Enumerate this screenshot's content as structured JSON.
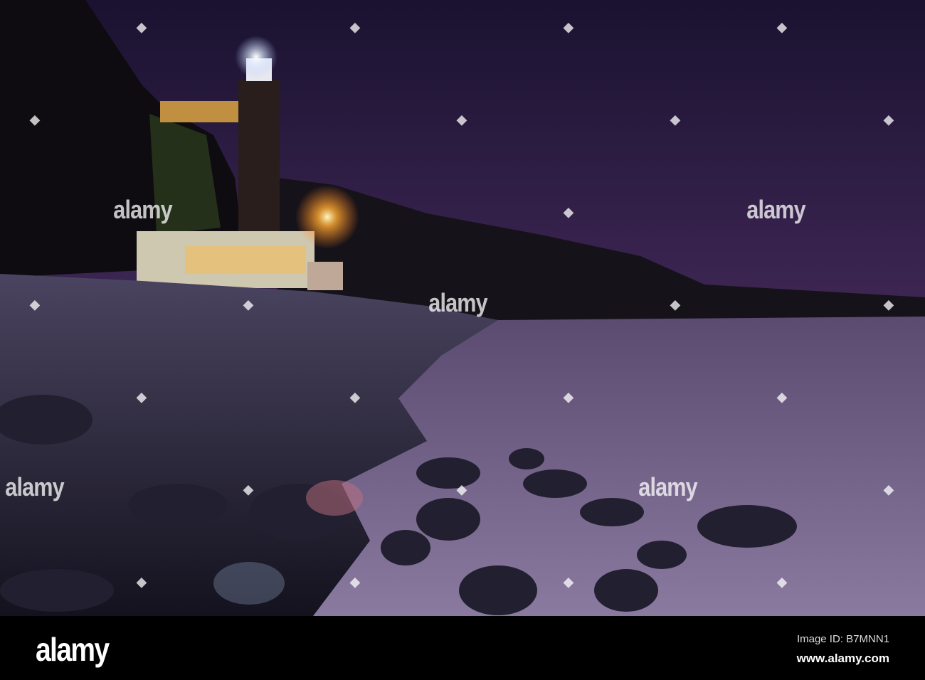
{
  "photo": {
    "subject": "lighthouse"
  },
  "watermark": {
    "text": "alamy",
    "diamond": "◆"
  },
  "footer": {
    "logo": "alamy",
    "image_id": "Image ID: B7MNN1",
    "url": "www.alamy.com"
  },
  "colors": {
    "sky_top": "#1c1330",
    "sky_glow": "#6a3a6e",
    "sea": "#7a6a8e",
    "light": "#ffb040"
  }
}
